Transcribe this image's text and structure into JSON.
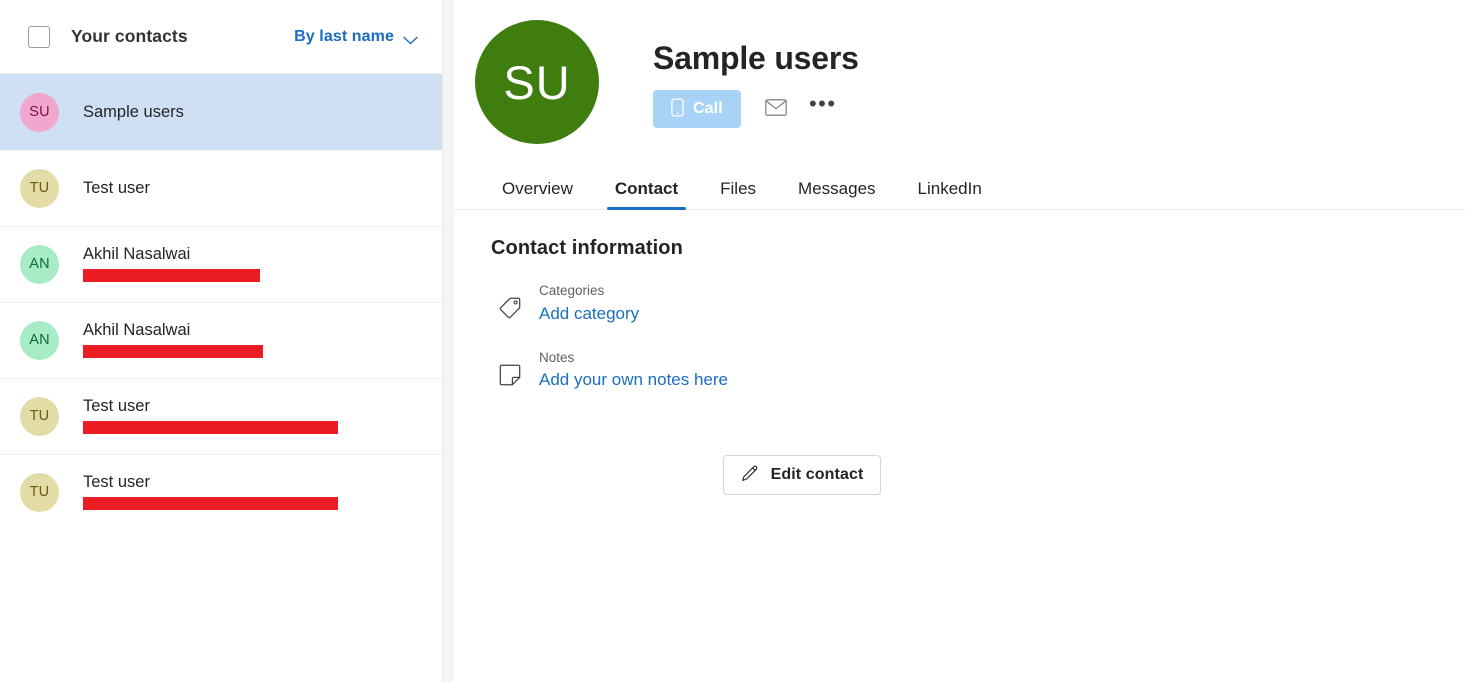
{
  "sidebar": {
    "header": {
      "select_all_checkbox": "select-all",
      "title": "Your contacts",
      "sort_label": "By last name",
      "sort_chevron_icon": "chevron-down-icon"
    },
    "contacts": [
      {
        "initials": "SU",
        "name": "Sample users",
        "subtitle": "",
        "redacted": false,
        "redaction_width": 0,
        "selected": true,
        "avatar_bg": "#f0a6cd",
        "avatar_fg": "#7a1055"
      },
      {
        "initials": "TU",
        "name": "Test user",
        "subtitle": "",
        "redacted": false,
        "redaction_width": 0,
        "selected": false,
        "avatar_bg": "#e3dca6",
        "avatar_fg": "#6b5c11"
      },
      {
        "initials": "AN",
        "name": "Akhil Nasalwai",
        "subtitle": "redacted email address",
        "redacted": true,
        "redaction_width": 177,
        "selected": false,
        "avatar_bg": "#a8ecc6",
        "avatar_fg": "#0c6b38"
      },
      {
        "initials": "AN",
        "name": "Akhil Nasalwai",
        "subtitle": "redacted email address",
        "redacted": true,
        "redaction_width": 180,
        "selected": false,
        "avatar_bg": "#a8ecc6",
        "avatar_fg": "#0c6b38"
      },
      {
        "initials": "TU",
        "name": "Test user",
        "subtitle": "redacted email address",
        "redacted": true,
        "redaction_width": 255,
        "selected": false,
        "avatar_bg": "#e3dca6",
        "avatar_fg": "#6b5c11"
      },
      {
        "initials": "TU",
        "name": "Test user",
        "subtitle": "redacted email address",
        "redacted": true,
        "redaction_width": 255,
        "selected": false,
        "avatar_bg": "#e3dca6",
        "avatar_fg": "#6b5c11"
      }
    ]
  },
  "main": {
    "avatar_initials": "SU",
    "avatar_color": "#3f7d0e",
    "profile_name": "Sample users",
    "actions": {
      "call_label": "Call",
      "call_icon": "mobile-phone-icon",
      "call_bg": "#a9d2f7",
      "mail_icon": "envelope-icon",
      "more_icon": "more-horizontal-icon",
      "more_glyph": "•••"
    },
    "tabs": [
      {
        "label": "Overview",
        "active": false
      },
      {
        "label": "Contact",
        "active": true
      },
      {
        "label": "Files",
        "active": false
      },
      {
        "label": "Messages",
        "active": false
      },
      {
        "label": "LinkedIn",
        "active": false
      }
    ],
    "accent_color": "#1b6ec2",
    "contact_section": {
      "title": "Contact information",
      "items": [
        {
          "icon": "tag-icon",
          "label": "Categories",
          "link": "Add category"
        },
        {
          "icon": "note-icon",
          "label": "Notes",
          "link": "Add your own notes here"
        }
      ]
    },
    "edit_contact": {
      "label": "Edit contact",
      "icon": "pencil-icon"
    }
  }
}
